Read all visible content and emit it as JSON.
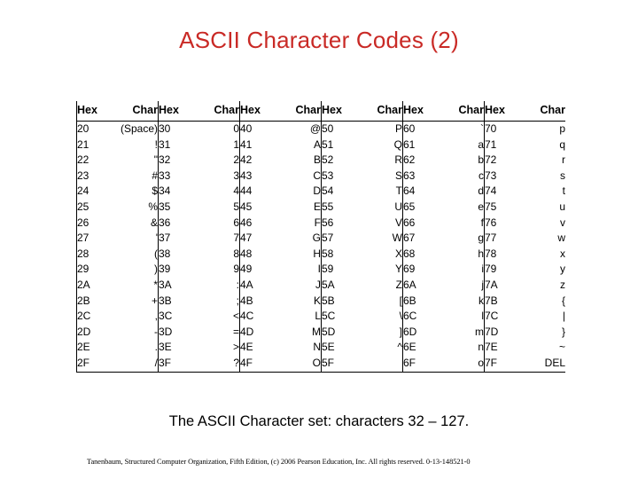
{
  "slide": {
    "title": "ASCII Character Codes (2)",
    "title_color": "#c92a26",
    "caption": "The ASCII Character set: characters 32 – 127.",
    "footer_credit": "Tanenbaum, Structured Computer Organization, Fifth Edition, (c) 2006 Pearson Education, Inc. All rights reserved. 0-13-148521-0"
  },
  "table": {
    "column_pair_count": 6,
    "row_count": 16,
    "headers": {
      "hex": "Hex",
      "char": "Char"
    },
    "header_row": [
      "Hex",
      "Char",
      "Hex",
      "Char",
      "Hex",
      "Char",
      "Hex",
      "Char",
      "Hex",
      "Char",
      "Hex",
      "Char"
    ],
    "rows": [
      [
        "20",
        "(Space)",
        "30",
        "0",
        "40",
        "@",
        "50",
        "P",
        "60",
        "`",
        "70",
        "p"
      ],
      [
        "21",
        "!",
        "31",
        "1",
        "41",
        "A",
        "51",
        "Q",
        "61",
        "a",
        "71",
        "q"
      ],
      [
        "22",
        "\"",
        "32",
        "2",
        "42",
        "B",
        "52",
        "R",
        "62",
        "b",
        "72",
        "r"
      ],
      [
        "23",
        "#",
        "33",
        "3",
        "43",
        "C",
        "53",
        "S",
        "63",
        "c",
        "73",
        "s"
      ],
      [
        "24",
        "$",
        "34",
        "4",
        "44",
        "D",
        "54",
        "T",
        "64",
        "d",
        "74",
        "t"
      ],
      [
        "25",
        "%",
        "35",
        "5",
        "45",
        "E",
        "55",
        "U",
        "65",
        "e",
        "75",
        "u"
      ],
      [
        "26",
        "&",
        "36",
        "6",
        "46",
        "F",
        "56",
        "V",
        "66",
        "f",
        "76",
        "v"
      ],
      [
        "27",
        "'",
        "37",
        "7",
        "47",
        "G",
        "57",
        "W",
        "67",
        "g",
        "77",
        "w"
      ],
      [
        "28",
        "(",
        "38",
        "8",
        "48",
        "H",
        "58",
        "X",
        "68",
        "h",
        "78",
        "x"
      ],
      [
        "29",
        ")",
        "39",
        "9",
        "49",
        "I",
        "59",
        "Y",
        "69",
        "i",
        "79",
        "y"
      ],
      [
        "2A",
        "*",
        "3A",
        ":",
        "4A",
        "J",
        "5A",
        "Z",
        "6A",
        "j",
        "7A",
        "z"
      ],
      [
        "2B",
        "+",
        "3B",
        ";",
        "4B",
        "K",
        "5B",
        "[",
        "6B",
        "k",
        "7B",
        "{"
      ],
      [
        "2C",
        ",",
        "3C",
        "<",
        "4C",
        "L",
        "5C",
        "\\",
        "6C",
        "l",
        "7C",
        "|"
      ],
      [
        "2D",
        "-",
        "3D",
        "=",
        "4D",
        "M",
        "5D",
        "]",
        "6D",
        "m",
        "7D",
        "}"
      ],
      [
        "2E",
        ".",
        "3E",
        ">",
        "4E",
        "N",
        "5E",
        "^",
        "6E",
        "n",
        "7E",
        "~"
      ],
      [
        "2F",
        "/",
        "3F",
        "?",
        "4F",
        "O",
        "5F",
        "",
        "6F",
        "o",
        "7F",
        "DEL"
      ]
    ]
  }
}
